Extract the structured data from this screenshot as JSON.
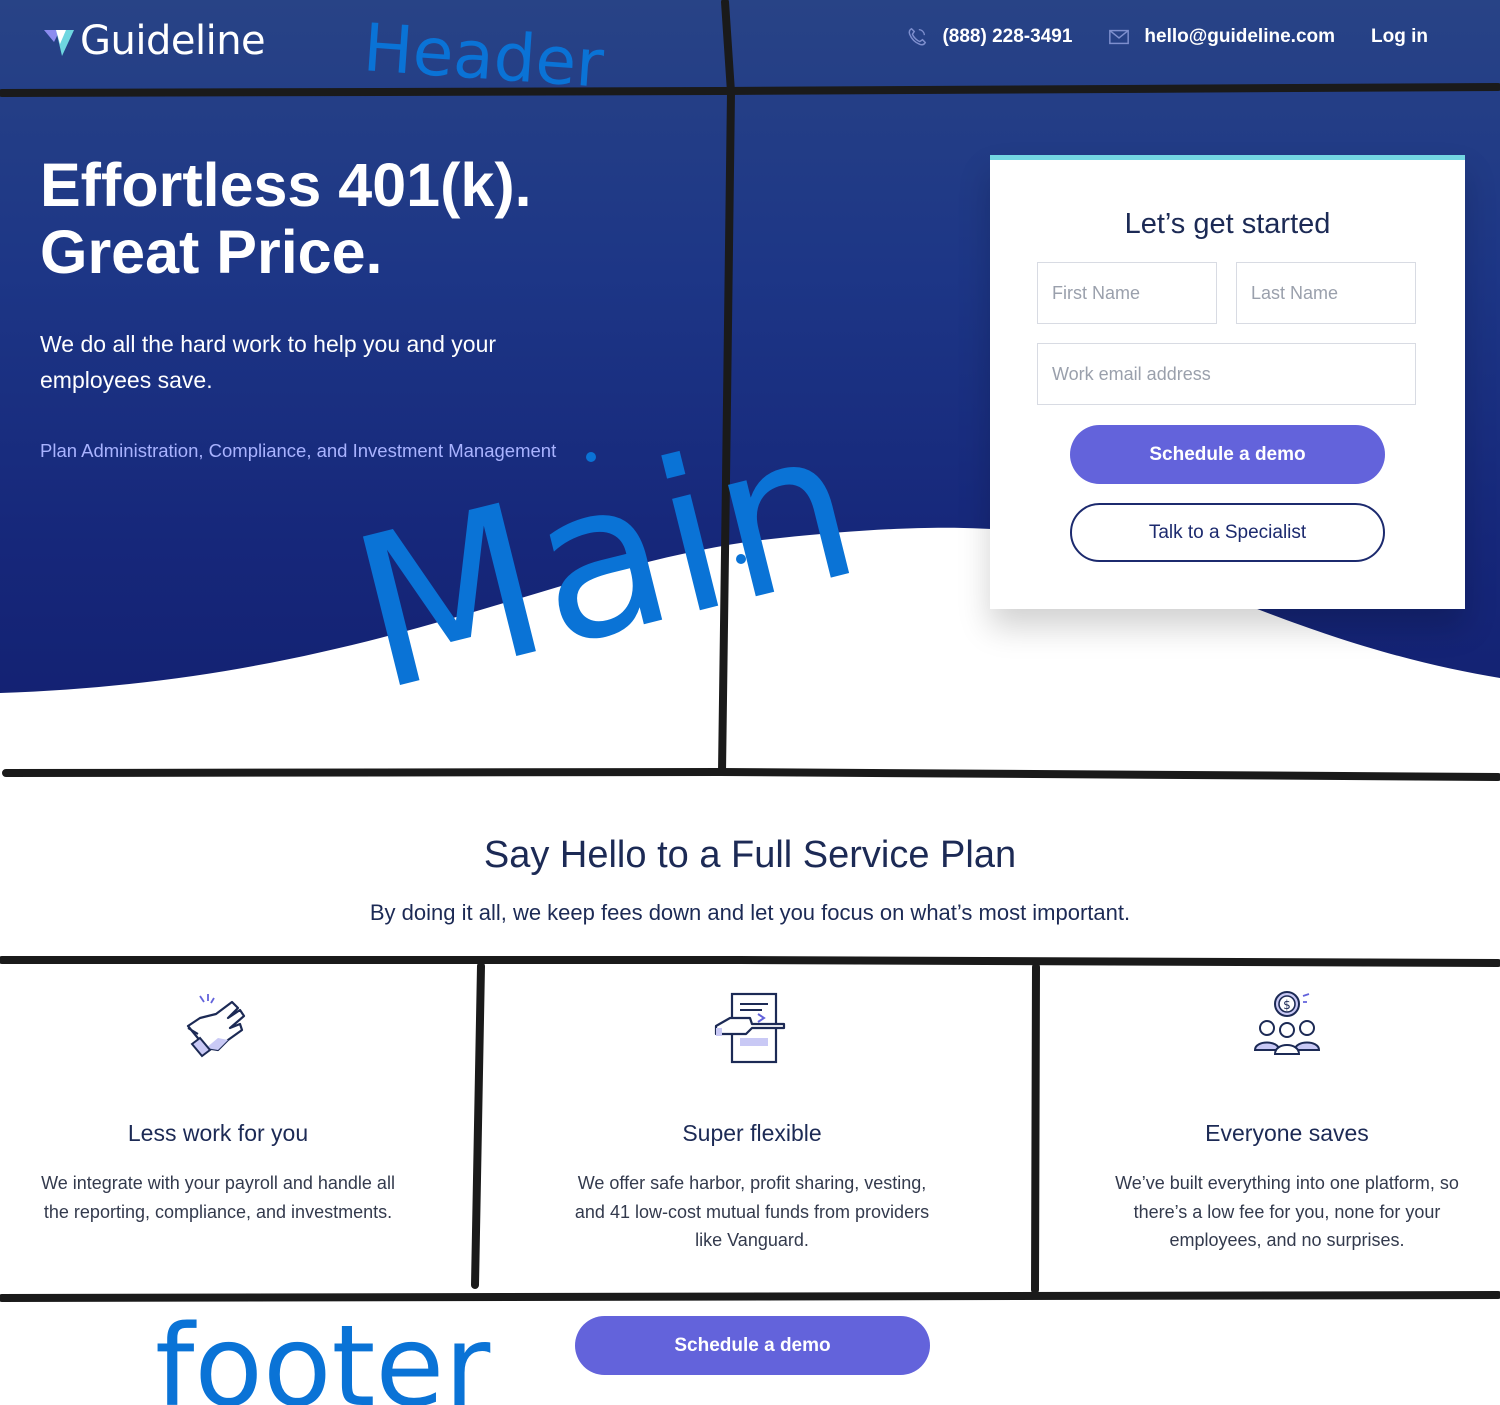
{
  "header": {
    "brand": "Guideline",
    "phone": "(888) 228-3491",
    "email": "hello@guideline.com",
    "login": "Log in",
    "icons": [
      "phone-icon",
      "mail-icon"
    ]
  },
  "hero": {
    "title_line1": "Effortless 401(k).",
    "title_line2": "Great Price.",
    "subtitle": "We do all the hard work to help you and your employees save.",
    "link": "Plan Administration, Compliance, and Investment Management"
  },
  "form": {
    "title": "Let’s get started",
    "first_name_placeholder": "First Name",
    "last_name_placeholder": "Last Name",
    "email_placeholder": "Work email address",
    "primary_button": "Schedule a demo",
    "secondary_button": "Talk to a Specialist"
  },
  "features_section": {
    "title": "Say Hello to a Full Service Plan",
    "subtitle": "By doing it all, we keep fees down and let you focus on what’s most important.",
    "items": [
      {
        "icon": "handshake-icon",
        "title": "Less work for you",
        "text": "We integrate with your payroll and handle all the reporting, compliance, and investments."
      },
      {
        "icon": "document-icon",
        "title": "Super flexible",
        "text": "We offer safe harbor, profit sharing, vesting, and 41 low-cost mutual funds from providers like Vanguard."
      },
      {
        "icon": "people-savings-icon",
        "title": "Everyone saves",
        "text": "We’ve built everything into one platform, so there’s a low fee for you, none for your employees, and no surprises."
      }
    ]
  },
  "footer": {
    "button": "Schedule a demo"
  },
  "annotations": {
    "header_label": "Header",
    "main_label": "Main",
    "footer_label": "footer"
  },
  "colors": {
    "hero_dark": "#121f6f",
    "hero_light": "#284386",
    "accent": "#6363db",
    "card_top": "#74d7e2",
    "annotation": "#0a73d6"
  }
}
